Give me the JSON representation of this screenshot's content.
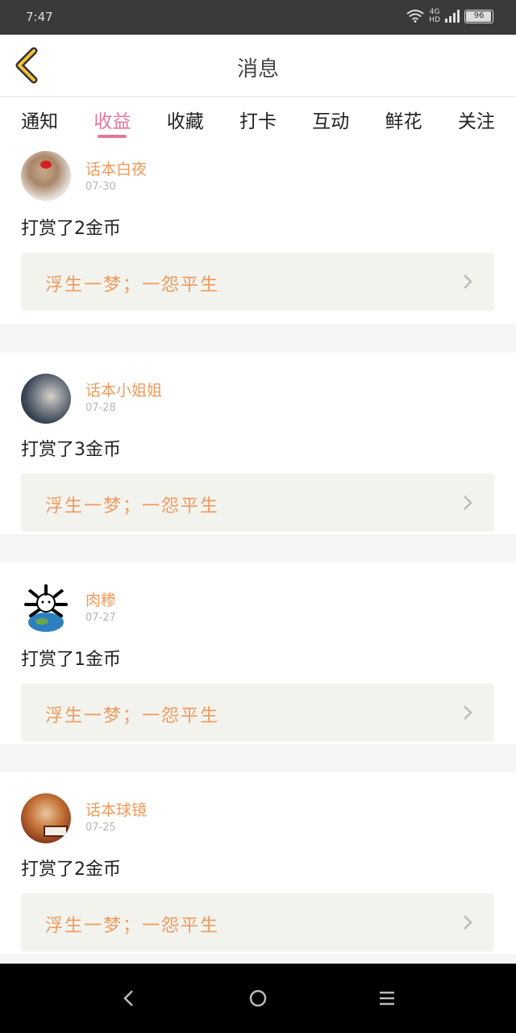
{
  "status": {
    "time": "7:47",
    "network": "4G",
    "hd": "HD",
    "battery": "96"
  },
  "header": {
    "title": "消息",
    "back_icon": "chevron-left-icon"
  },
  "tabs": [
    {
      "label": "通知"
    },
    {
      "label": "收益"
    },
    {
      "label": "收藏"
    },
    {
      "label": "打卡"
    },
    {
      "label": "互动"
    },
    {
      "label": "鲜花"
    },
    {
      "label": "关注"
    }
  ],
  "active_tab": "收益",
  "colors": {
    "accent": "#e3779e",
    "name": "#ef9a5c",
    "box_bg": "#f3f3ee"
  },
  "feed": [
    {
      "user": "话本白夜",
      "date": "07-30",
      "action": "打赏了2金币",
      "book": "浮生一梦；一怨平生"
    },
    {
      "user": "话本小姐姐",
      "date": "07-28",
      "action": "打赏了3金币",
      "book": "浮生一梦；一怨平生"
    },
    {
      "user": "肉糁",
      "date": "07-27",
      "action": "打赏了1金币",
      "book": "浮生一梦；一怨平生"
    },
    {
      "user": "话本球镜",
      "date": "07-25",
      "action": "打赏了2金币",
      "book": "浮生一梦；一怨平生"
    }
  ],
  "nav": {
    "back": "back-triangle-icon",
    "home": "home-circle-icon",
    "menu": "menu-lines-icon"
  }
}
